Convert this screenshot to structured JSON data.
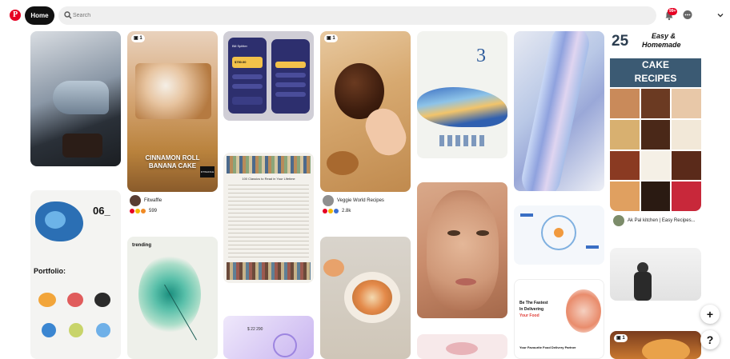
{
  "header": {
    "logo_letter": "P",
    "home_label": "Home",
    "search_placeholder": "Search",
    "notification_badge": "99+"
  },
  "pins": {
    "cinnamon": {
      "title": "CINNAMON ROLL\nBANANA CAKE",
      "brand": "FITWAFFLE",
      "count": "1",
      "author": "Fitwaffle",
      "reactions": "599"
    },
    "chocolate": {
      "count": "1",
      "author": "Veggie World Recipes",
      "reactions": "2.8k"
    },
    "cake_recipes": {
      "line1": "25",
      "line2": "Easy &",
      "line3": "Homemade",
      "line4": "CAKE",
      "line5": "RECIPES",
      "author": "Ak Pal kitchen | Easy Recipes..."
    },
    "portfolio": {
      "number": "06_",
      "title": "Portfolio:"
    },
    "trending": {
      "title": "trending"
    },
    "classics": {
      "title": "100 Classics to Read in Your Lifetime"
    },
    "food_delivery": {
      "line1": "Be The Fastest",
      "line2": "In Delivering",
      "line3": "Your Food",
      "footer": "Your Favourite Food Delivery Partner"
    },
    "wave": {
      "number": "3"
    },
    "bottom_pin": {
      "count": "1"
    },
    "dashboard": {
      "value": "$ 22 290"
    },
    "app_ui": {
      "title1": "Bill Splitter",
      "amount": "$750.00"
    }
  },
  "fabs": {
    "plus": "+",
    "help": "?"
  },
  "colors": {
    "brand": "#e60023",
    "dark": "#111111",
    "search_bg": "#efefef"
  }
}
